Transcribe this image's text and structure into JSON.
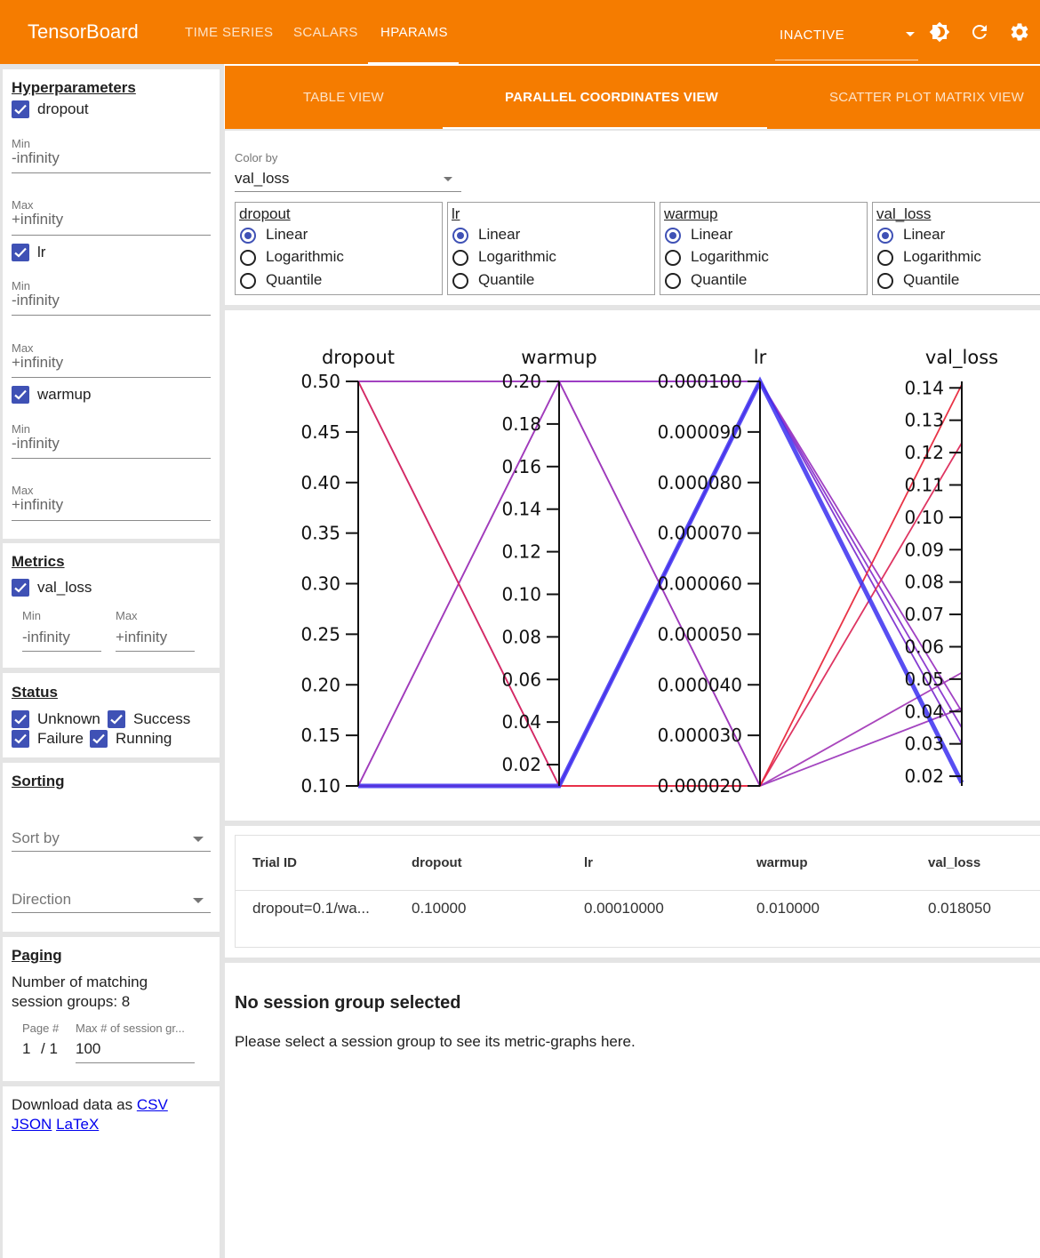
{
  "app": {
    "brand": "TensorBoard",
    "nav_tabs": [
      "TIME SERIES",
      "SCALARS",
      "HPARAMS"
    ],
    "active_tab": "HPARAMS",
    "run_select": "INACTIVE",
    "icons": [
      "brightness-icon",
      "refresh-icon",
      "settings-icon"
    ]
  },
  "sidebar": {
    "hyperparameters": {
      "title": "Hyperparameters",
      "min_label": "Min",
      "max_label": "Max",
      "items": [
        {
          "name": "dropout",
          "checked": true,
          "min": "-infinity",
          "max": "+infinity"
        },
        {
          "name": "lr",
          "checked": true,
          "min": "-infinity",
          "max": "+infinity"
        },
        {
          "name": "warmup",
          "checked": true,
          "min": "-infinity",
          "max": "+infinity"
        }
      ]
    },
    "metrics": {
      "title": "Metrics",
      "items": [
        {
          "name": "val_loss",
          "checked": true,
          "min_label": "Min",
          "max_label": "Max",
          "min": "-infinity",
          "max": "+infinity"
        }
      ]
    },
    "status": {
      "title": "Status",
      "items": [
        {
          "label": "Unknown",
          "checked": true
        },
        {
          "label": "Success",
          "checked": true
        },
        {
          "label": "Failure",
          "checked": true
        },
        {
          "label": "Running",
          "checked": true
        }
      ]
    },
    "sorting": {
      "title": "Sorting",
      "sort_by": "Sort by",
      "direction": "Direction"
    },
    "paging": {
      "title": "Paging",
      "matching": "Number of matching session groups: 8",
      "page_label": "Page #",
      "page_value": "1",
      "page_total": "/ 1",
      "max_label": "Max # of session gr...",
      "max_value": "100"
    },
    "download": {
      "prefix": "Download data as",
      "csv": "CSV",
      "json": "JSON",
      "latex": "LaTeX"
    }
  },
  "views": {
    "tabs": [
      "TABLE VIEW",
      "PARALLEL COORDINATES VIEW",
      "SCATTER PLOT MATRIX VIEW"
    ],
    "active": "PARALLEL COORDINATES VIEW"
  },
  "color_by": {
    "label": "Color by",
    "value": "val_loss"
  },
  "scale_options": {
    "options": [
      "Linear",
      "Logarithmic",
      "Quantile"
    ],
    "columns": [
      {
        "name": "dropout",
        "selected": "Linear"
      },
      {
        "name": "lr",
        "selected": "Linear"
      },
      {
        "name": "warmup",
        "selected": "Linear"
      },
      {
        "name": "val_loss",
        "selected": "Linear"
      }
    ]
  },
  "chart_data": {
    "type": "parallel-coordinates",
    "axes": [
      {
        "name": "dropout",
        "range": [
          0.1,
          0.5
        ],
        "ticks": [
          "0.50",
          "0.45",
          "0.40",
          "0.35",
          "0.30",
          "0.25",
          "0.20",
          "0.15",
          "0.10"
        ],
        "tick_values": [
          0.5,
          0.45,
          0.4,
          0.35,
          0.3,
          0.25,
          0.2,
          0.15,
          0.1
        ]
      },
      {
        "name": "warmup",
        "range": [
          0.01,
          0.2
        ],
        "ticks": [
          "0.20",
          "0.18",
          "0.16",
          "0.14",
          "0.12",
          "0.10",
          "0.08",
          "0.06",
          "0.04",
          "0.02"
        ],
        "tick_values": [
          0.2,
          0.18,
          0.16,
          0.14,
          0.12,
          0.1,
          0.08,
          0.06,
          0.04,
          0.02
        ]
      },
      {
        "name": "lr",
        "range": [
          2e-05,
          0.0001
        ],
        "ticks": [
          "0.000100",
          "0.000090",
          "0.000080",
          "0.000070",
          "0.000060",
          "0.000050",
          "0.000040",
          "0.000030",
          "0.000020"
        ],
        "tick_values": [
          0.0001,
          9e-05,
          8e-05,
          7e-05,
          6e-05,
          5e-05,
          4e-05,
          3e-05,
          2e-05
        ]
      },
      {
        "name": "val_loss",
        "range": [
          0.017,
          0.142
        ],
        "ticks": [
          "0.14",
          "0.13",
          "0.12",
          "0.11",
          "0.10",
          "0.09",
          "0.08",
          "0.07",
          "0.06",
          "0.05",
          "0.04",
          "0.03",
          "0.02"
        ],
        "tick_values": [
          0.14,
          0.13,
          0.12,
          0.11,
          0.1,
          0.09,
          0.08,
          0.07,
          0.06,
          0.05,
          0.04,
          0.03,
          0.02
        ]
      }
    ],
    "lines": [
      {
        "dropout": 0.1,
        "warmup": 0.01,
        "lr": 0.0001,
        "val_loss": 0.018,
        "color": "#3b2ff0",
        "highlight": true
      },
      {
        "dropout": 0.1,
        "warmup": 0.2,
        "lr": 0.0001,
        "val_loss": 0.03,
        "color": "#7e30d0",
        "highlight": false
      },
      {
        "dropout": 0.5,
        "warmup": 0.01,
        "lr": 0.0001,
        "val_loss": 0.035,
        "color": "#8a35cc",
        "highlight": false
      },
      {
        "dropout": 0.5,
        "warmup": 0.2,
        "lr": 0.0001,
        "val_loss": 0.04,
        "color": "#9b36c0",
        "highlight": false
      },
      {
        "dropout": 0.1,
        "warmup": 0.2,
        "lr": 2e-05,
        "val_loss": 0.052,
        "color": "#a43cb8",
        "highlight": false
      },
      {
        "dropout": 0.5,
        "warmup": 0.2,
        "lr": 2e-05,
        "val_loss": 0.041,
        "color": "#9e3bbd",
        "highlight": false
      },
      {
        "dropout": 0.5,
        "warmup": 0.01,
        "lr": 2e-05,
        "val_loss": 0.123,
        "color": "#dc2a5a",
        "highlight": false
      },
      {
        "dropout": 0.1,
        "warmup": 0.01,
        "lr": 2e-05,
        "val_loss": 0.141,
        "color": "#e8283c",
        "highlight": false
      }
    ]
  },
  "table": {
    "headers": [
      "Trial ID",
      "dropout",
      "lr",
      "warmup",
      "val_loss"
    ],
    "rows": [
      [
        "dropout=0.1/wa...",
        "0.10000",
        "0.00010000",
        "0.010000",
        "0.018050"
      ]
    ]
  },
  "session": {
    "title": "No session group selected",
    "message": "Please select a session group to see its metric-graphs here."
  }
}
